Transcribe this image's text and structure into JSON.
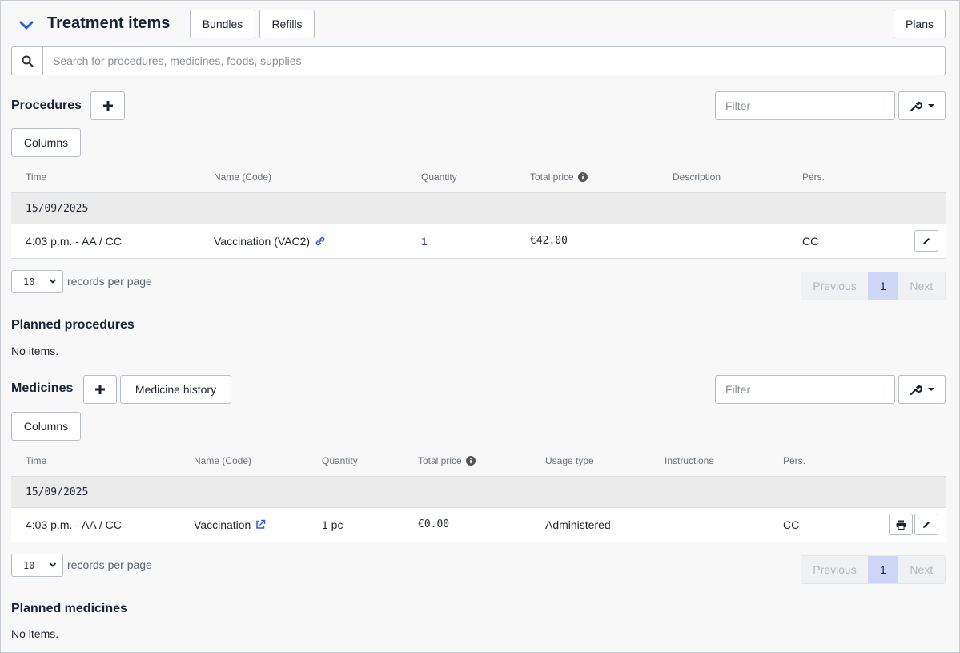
{
  "header": {
    "title": "Treatment items",
    "bundles_label": "Bundles",
    "refills_label": "Refills",
    "plans_label": "Plans"
  },
  "search": {
    "placeholder": "Search for procedures, medicines, foods, supplies"
  },
  "procedures": {
    "title": "Procedures",
    "filter_placeholder": "Filter",
    "columns_label": "Columns",
    "headers": [
      "Time",
      "Name (Code)",
      "Quantity",
      "Total price",
      "Description",
      "Pers."
    ],
    "date_group": "15/09/2025",
    "row": {
      "time": "4:03 p.m. - AA / CC",
      "name": "Vaccination (VAC2)",
      "quantity": "1",
      "total_price": "€42.00",
      "description": "",
      "pers": "CC"
    },
    "page_size": "10",
    "records_per_page": "records per page",
    "pager": {
      "previous": "Previous",
      "current": "1",
      "next": "Next"
    }
  },
  "planned_procedures": {
    "title": "Planned procedures",
    "empty": "No items."
  },
  "medicines": {
    "title": "Medicines",
    "history_label": "Medicine history",
    "filter_placeholder": "Filter",
    "columns_label": "Columns",
    "headers": [
      "Time",
      "Name (Code)",
      "Quantity",
      "Total price",
      "Usage type",
      "Instructions",
      "Pers."
    ],
    "date_group": "15/09/2025",
    "row": {
      "time": "4:03 p.m. - AA / CC",
      "name": "Vaccination",
      "quantity": "1 pc",
      "total_price": "€0.00",
      "usage_type": "Administered",
      "instructions": "",
      "pers": "CC"
    },
    "page_size": "10",
    "records_per_page": "records per page",
    "pager": {
      "previous": "Previous",
      "current": "1",
      "next": "Next"
    }
  },
  "planned_medicines": {
    "title": "Planned medicines",
    "empty": "No items."
  },
  "colors": {
    "accent": "#2f5bd3",
    "link": "#2f4a8a",
    "pager_active": "#cdd6f4",
    "date_row_bg": "#ebebeb"
  }
}
